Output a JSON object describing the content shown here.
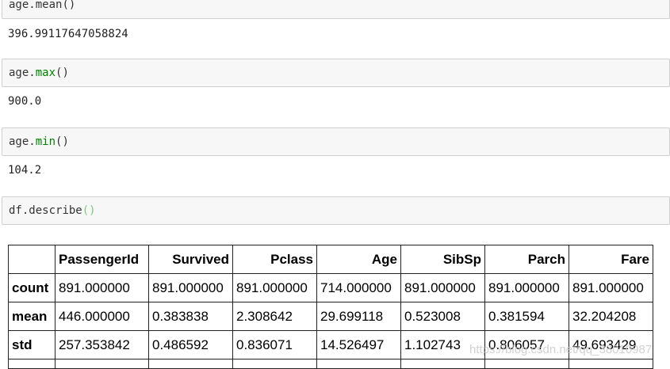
{
  "cells": [
    {
      "prefix": "age.",
      "func": "mean",
      "paren": "()",
      "output": "396.99117647058824"
    },
    {
      "prefix": "age.",
      "func": "max",
      "paren": "()",
      "output": "900.0"
    },
    {
      "prefix": "age.",
      "func": "min",
      "paren": "()",
      "output": "104.2"
    },
    {
      "prefix": "df.",
      "func": "describe",
      "paren": "()"
    }
  ],
  "table": {
    "columns": [
      "",
      "PassengerId",
      "Survived",
      "Pclass",
      "Age",
      "SibSp",
      "Parch",
      "Fare"
    ],
    "rows": [
      {
        "label": "count",
        "values": [
          "891.000000",
          "891.000000",
          "891.000000",
          "714.000000",
          "891.000000",
          "891.000000",
          "891.000000"
        ]
      },
      {
        "label": "mean",
        "values": [
          "446.000000",
          "0.383838",
          "2.308642",
          "29.699118",
          "0.523008",
          "0.381594",
          "32.204208"
        ]
      },
      {
        "label": "std",
        "values": [
          "257.353842",
          "0.486592",
          "0.836071",
          "14.526497",
          "1.102743",
          "0.806057",
          "49.693429"
        ]
      }
    ]
  },
  "watermark": "https://blog.csdn.net/qq_38010987"
}
